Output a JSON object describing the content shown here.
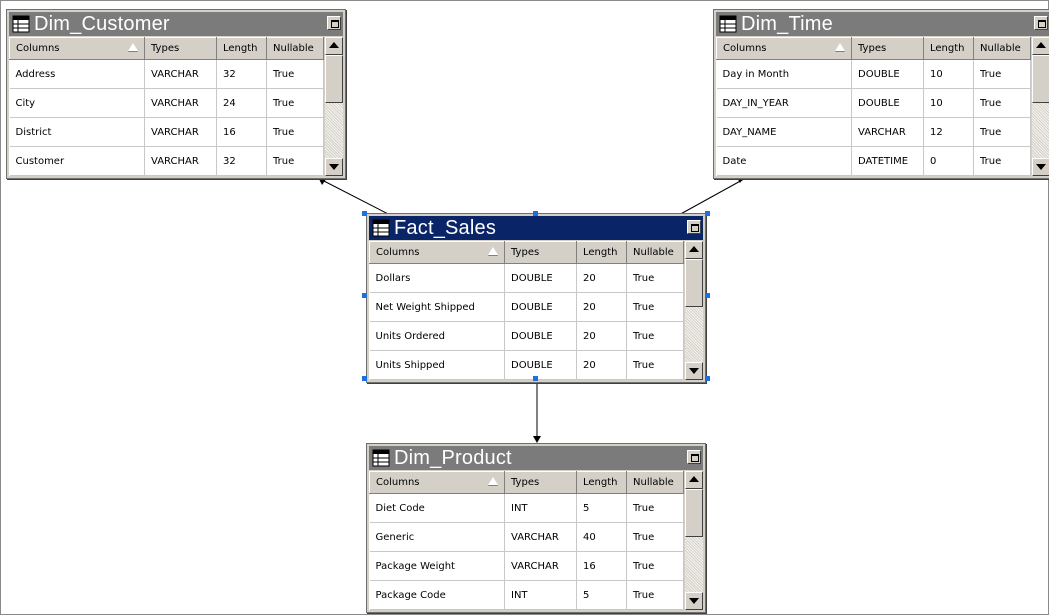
{
  "columns_header": {
    "name": "Columns",
    "type": "Types",
    "length": "Length",
    "nullable": "Nullable"
  },
  "tables": {
    "dim_customer": {
      "title": "Dim_Customer",
      "rows": [
        {
          "name": "Address",
          "type": "VARCHAR",
          "length": "32",
          "nullable": "True"
        },
        {
          "name": "City",
          "type": "VARCHAR",
          "length": "24",
          "nullable": "True"
        },
        {
          "name": "District",
          "type": "VARCHAR",
          "length": "16",
          "nullable": "True"
        },
        {
          "name": "Customer",
          "type": "VARCHAR",
          "length": "32",
          "nullable": "True"
        }
      ]
    },
    "dim_time": {
      "title": "Dim_Time",
      "rows": [
        {
          "name": "Day in Month",
          "type": "DOUBLE",
          "length": "10",
          "nullable": "True"
        },
        {
          "name": "DAY_IN_YEAR",
          "type": "DOUBLE",
          "length": "10",
          "nullable": "True"
        },
        {
          "name": "DAY_NAME",
          "type": "VARCHAR",
          "length": "12",
          "nullable": "True"
        },
        {
          "name": "Date",
          "type": "DATETIME",
          "length": "0",
          "nullable": "True"
        }
      ]
    },
    "fact_sales": {
      "title": "Fact_Sales",
      "rows": [
        {
          "name": "Dollars",
          "type": "DOUBLE",
          "length": "20",
          "nullable": "True"
        },
        {
          "name": "Net Weight Shipped",
          "type": "DOUBLE",
          "length": "20",
          "nullable": "True"
        },
        {
          "name": "Units Ordered",
          "type": "DOUBLE",
          "length": "20",
          "nullable": "True"
        },
        {
          "name": "Units Shipped",
          "type": "DOUBLE",
          "length": "20",
          "nullable": "True"
        }
      ]
    },
    "dim_product": {
      "title": "Dim_Product",
      "rows": [
        {
          "name": "Diet Code",
          "type": "INT",
          "length": "5",
          "nullable": "True"
        },
        {
          "name": "Generic",
          "type": "VARCHAR",
          "length": "40",
          "nullable": "True"
        },
        {
          "name": "Package Weight",
          "type": "VARCHAR",
          "length": "16",
          "nullable": "True"
        },
        {
          "name": "Package Code",
          "type": "INT",
          "length": "5",
          "nullable": "True"
        }
      ]
    }
  },
  "icons": {
    "table": "table-icon",
    "restore": "restore-window-icon"
  },
  "colors": {
    "title_bar_inactive": "#7b7b7b",
    "title_bar_selected": "#0a2468",
    "selection_handle": "#1e6fe0"
  }
}
